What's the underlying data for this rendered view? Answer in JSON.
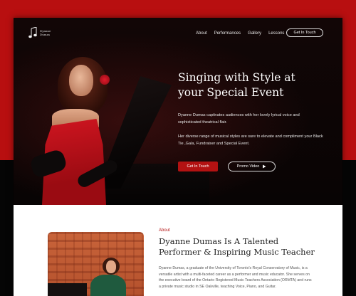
{
  "brand": {
    "logo_line1": "Dyanne",
    "logo_line2": "Dumas"
  },
  "nav": {
    "items": [
      "About",
      "Performances",
      "Gallery",
      "Lessons"
    ],
    "cta": "Get In Touch"
  },
  "hero": {
    "title": "Singing with Style at your Special Event",
    "paragraph1": "Dyanne Dumas captivates audiences with her lovely lyrical voice and sophisticated theatrical flair.",
    "paragraph2": "Her diverse range of musical styles are sure to elevate and compliment your Black Tie ,Gala, Fundraiser and Special Event.",
    "primary_button": "Get In Touch",
    "secondary_button": "Promo Video",
    "secondary_icon": "play-icon"
  },
  "about": {
    "label": "About",
    "title": "Dyanne Dumas Is A Talented Performer & Inspiring Music Teacher",
    "paragraph": "Dyanne Dumas, a graduate of the University of Toronto's Royal Conservatory of Music, is a versatile artist with a multi-faceted career as a performer and music educator. She serves on the executive board of the Ontario Registered Music Teachers Association (ORMTA) and runs a private music studio in SE Oakville, teaching Voice, Piano, and Guitar."
  },
  "colors": {
    "accent_red": "#b31212",
    "hero_bg": "#0a0606",
    "section_bg": "#ffffff"
  }
}
